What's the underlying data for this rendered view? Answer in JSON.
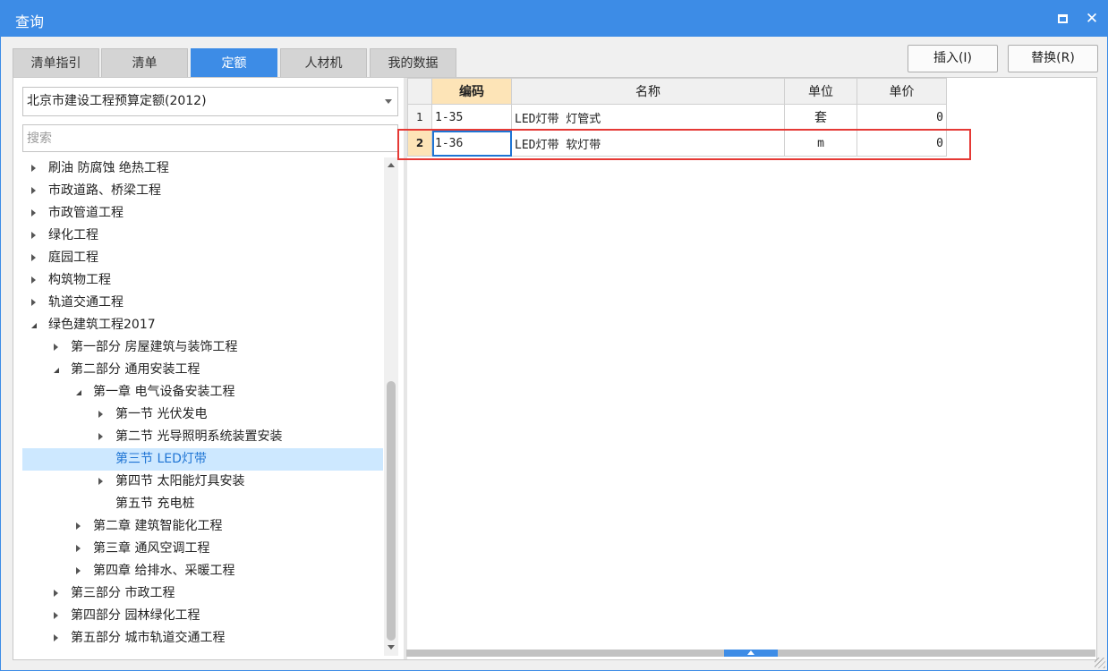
{
  "window": {
    "title": "查询"
  },
  "tabs": [
    {
      "label": "清单指引",
      "active": false
    },
    {
      "label": "清单",
      "active": false
    },
    {
      "label": "定额",
      "active": true
    },
    {
      "label": "人材机",
      "active": false
    },
    {
      "label": "我的数据",
      "active": false
    }
  ],
  "actions": {
    "insert_label": "插入(I)",
    "replace_label": "替换(R)"
  },
  "library": {
    "selected": "北京市建设工程预算定额(2012)"
  },
  "search": {
    "placeholder": "搜索"
  },
  "tree": [
    {
      "label": "刷油 防腐蚀 绝热工程",
      "level": 0,
      "state": "collapsed"
    },
    {
      "label": "市政道路、桥梁工程",
      "level": 0,
      "state": "collapsed"
    },
    {
      "label": "市政管道工程",
      "level": 0,
      "state": "collapsed"
    },
    {
      "label": "绿化工程",
      "level": 0,
      "state": "collapsed"
    },
    {
      "label": "庭园工程",
      "level": 0,
      "state": "collapsed"
    },
    {
      "label": "构筑物工程",
      "level": 0,
      "state": "collapsed"
    },
    {
      "label": "轨道交通工程",
      "level": 0,
      "state": "collapsed"
    },
    {
      "label": "绿色建筑工程2017",
      "level": 0,
      "state": "expanded"
    },
    {
      "label": "第一部分 房屋建筑与装饰工程",
      "level": 1,
      "state": "collapsed"
    },
    {
      "label": "第二部分 通用安装工程",
      "level": 1,
      "state": "expanded"
    },
    {
      "label": "第一章 电气设备安装工程",
      "level": 2,
      "state": "expanded"
    },
    {
      "label": "第一节 光伏发电",
      "level": 3,
      "state": "collapsed"
    },
    {
      "label": "第二节 光导照明系统装置安装",
      "level": 3,
      "state": "collapsed"
    },
    {
      "label": "第三节 LED灯带",
      "level": 3,
      "state": "leaf",
      "selected": true
    },
    {
      "label": "第四节 太阳能灯具安装",
      "level": 3,
      "state": "collapsed"
    },
    {
      "label": "第五节 充电桩",
      "level": 3,
      "state": "leaf"
    },
    {
      "label": "第二章 建筑智能化工程",
      "level": 2,
      "state": "collapsed"
    },
    {
      "label": "第三章 通风空调工程",
      "level": 2,
      "state": "collapsed"
    },
    {
      "label": "第四章 给排水、采暖工程",
      "level": 2,
      "state": "collapsed"
    },
    {
      "label": "第三部分 市政工程",
      "level": 1,
      "state": "collapsed"
    },
    {
      "label": "第四部分 园林绿化工程",
      "level": 1,
      "state": "collapsed"
    },
    {
      "label": "第五部分 城市轨道交通工程",
      "level": 1,
      "state": "collapsed"
    }
  ],
  "grid": {
    "headers": {
      "code": "编码",
      "name": "名称",
      "unit": "单位",
      "price": "单价"
    },
    "rows": [
      {
        "num": "1",
        "code": "1-35",
        "name": "LED灯带 灯管式",
        "unit": "套",
        "price": "0"
      },
      {
        "num": "2",
        "code": "1-36",
        "name": "LED灯带 软灯带",
        "unit": "m",
        "price": "0"
      }
    ]
  },
  "colors": {
    "accent": "#3d8ce6",
    "highlight_header": "#fde4b7",
    "selection_bg": "#cde8ff",
    "annotation_red": "#e53935"
  }
}
